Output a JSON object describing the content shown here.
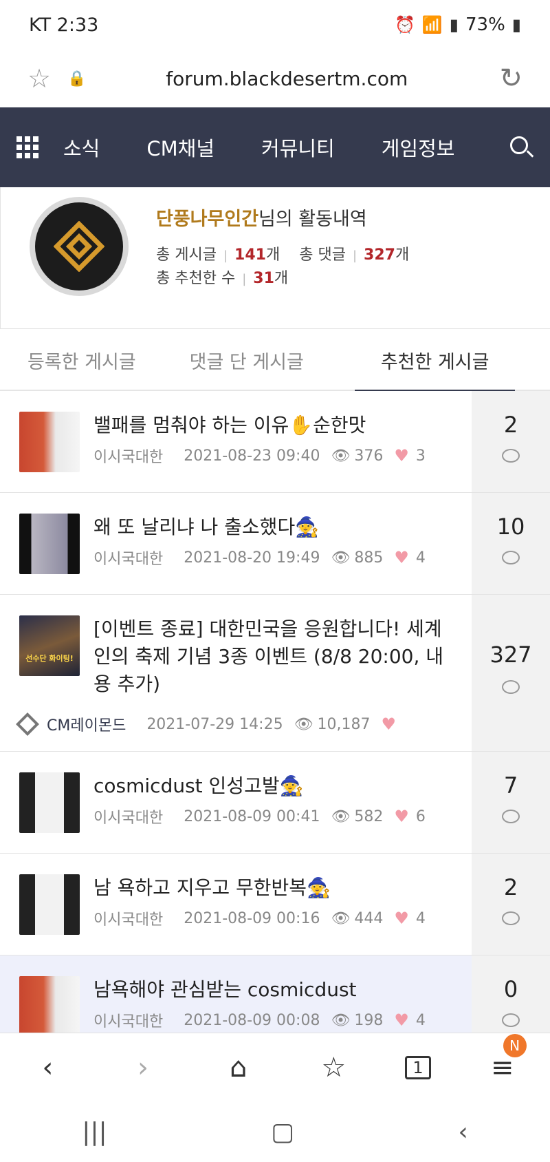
{
  "status": {
    "carrier_time": "KT 2:33",
    "battery": "73%"
  },
  "browser": {
    "url": "forum.blackdesertm.com"
  },
  "nav": {
    "items": [
      "소식",
      "CM채널",
      "커뮤니티",
      "게임정보"
    ]
  },
  "profile": {
    "name": "단풍나무인간",
    "title_suffix": "님의 활동내역",
    "posts_label": "총 게시글",
    "posts_value": "141",
    "comments_label": "총 댓글",
    "comments_value": "327",
    "likes_label": "총 추천한 수",
    "likes_value": "31",
    "unit": "개"
  },
  "tabs": [
    "등록한 게시글",
    "댓글 단 게시글",
    "추천한 게시글"
  ],
  "posts": [
    {
      "title": "밸패를 멈춰야 하는 이유✋순한맛",
      "author": "이시국대한",
      "date": "2021-08-23 09:40",
      "views": "376",
      "likes": "3",
      "comments": "2"
    },
    {
      "title": "왜 또 날리냐 나 출소했다🧙",
      "author": "이시국대한",
      "date": "2021-08-20 19:49",
      "views": "885",
      "likes": "4",
      "comments": "10"
    },
    {
      "title": "[이벤트 종료] 대한민국을 응원합니다! 세계인의 축제 기념 3종 이벤트 (8/8 20:00, 내용 추가)",
      "author": "CM레이몬드",
      "date": "2021-07-29 14:25",
      "views": "10,187",
      "likes": "",
      "comments": "327"
    },
    {
      "title": "cosmicdust 인성고발🧙",
      "author": "이시국대한",
      "date": "2021-08-09 00:41",
      "views": "582",
      "likes": "6",
      "comments": "7"
    },
    {
      "title": "남 욕하고 지우고 무한반복🧙",
      "author": "이시국대한",
      "date": "2021-08-09 00:16",
      "views": "444",
      "likes": "4",
      "comments": "2"
    },
    {
      "title": "남욕해야 관심받는 cosmicdust",
      "author": "이시국대한",
      "date": "2021-08-09 00:08",
      "views": "198",
      "likes": "4",
      "comments": "0"
    }
  ],
  "thumb_texts": {
    "event_banner": "선수단 화이팅!"
  },
  "bottom_nav": {
    "tabs_count": "1",
    "menu_badge": "N"
  }
}
